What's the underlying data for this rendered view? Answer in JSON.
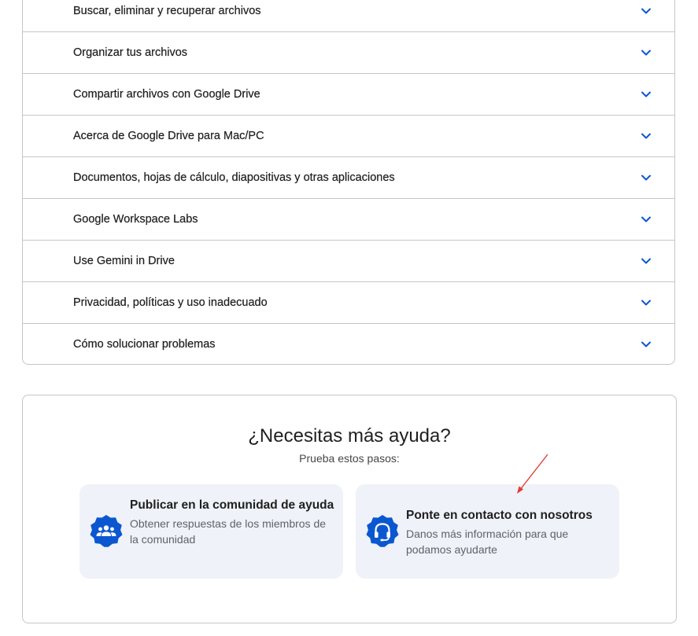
{
  "topics": [
    {
      "label": "Buscar, eliminar y recuperar archivos"
    },
    {
      "label": "Organizar tus archivos"
    },
    {
      "label": "Compartir archivos con Google Drive"
    },
    {
      "label": "Acerca de Google Drive para Mac/PC"
    },
    {
      "label": "Documentos, hojas de cálculo, diapositivas y otras aplicaciones"
    },
    {
      "label": "Google Workspace Labs"
    },
    {
      "label": "Use Gemini in Drive"
    },
    {
      "label": "Privacidad, políticas y uso inadecuado"
    },
    {
      "label": "Cómo solucionar problemas"
    }
  ],
  "help": {
    "title": "¿Necesitas más ayuda?",
    "subtitle": "Prueba estos pasos:",
    "options": [
      {
        "title": "Publicar en la comunidad de ayuda",
        "description": "Obtener respuestas de los miembros de la comunidad",
        "icon": "community-icon"
      },
      {
        "title": "Ponte en contacto con nosotros",
        "description": "Danos más información para que podamos ayudarte",
        "icon": "headset-icon"
      }
    ]
  },
  "colors": {
    "accent": "#0b57d0",
    "card_background": "#eff2f8",
    "border": "#c4c7c5",
    "annotation_arrow": "#e53935"
  }
}
